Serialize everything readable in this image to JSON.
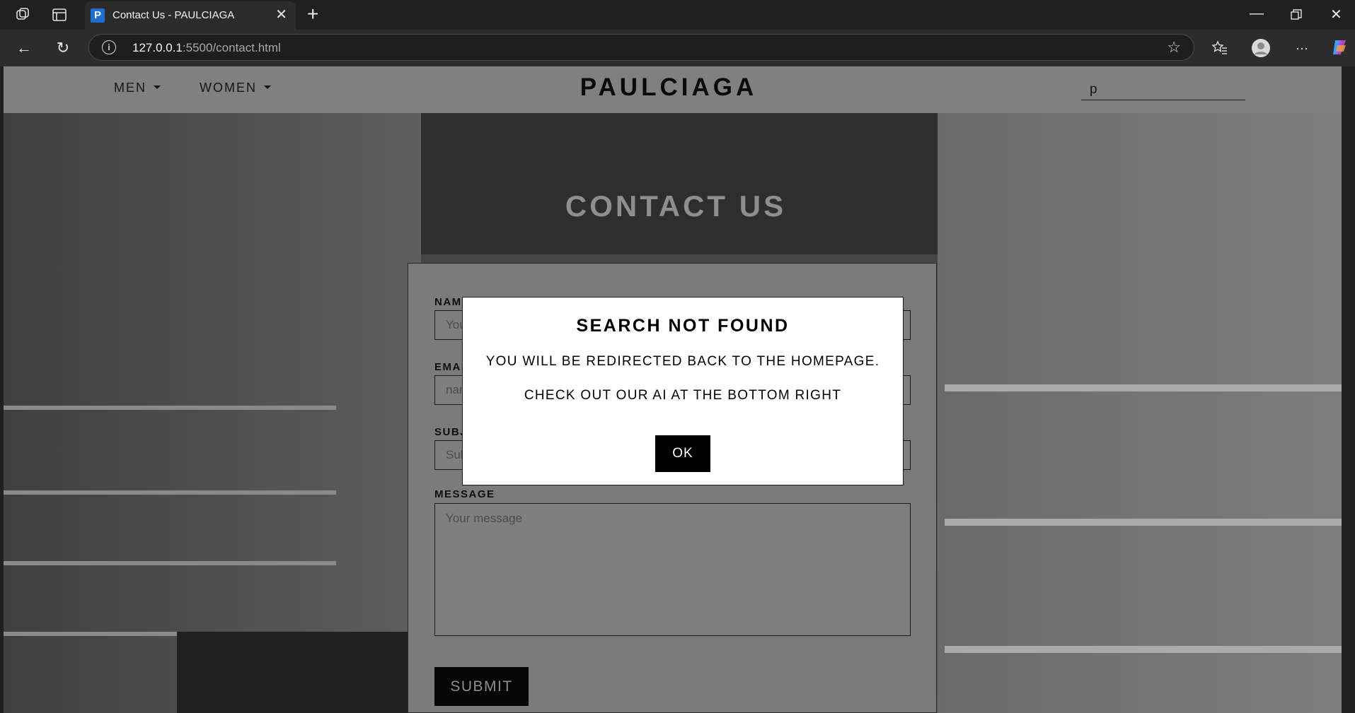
{
  "browser": {
    "tab": {
      "favicon_letter": "P",
      "title": "Contact Us - PAULCIAGA"
    },
    "address": {
      "host": "127.0.0.1",
      "rest": ":5500/contact.html"
    }
  },
  "nav": {
    "items": [
      {
        "label": "MEN"
      },
      {
        "label": "WOMEN"
      }
    ],
    "brand": "PAULCIAGA",
    "search_value": "p"
  },
  "page": {
    "title": "CONTACT US"
  },
  "form": {
    "name_label": "NAME",
    "name_placeholder": "Your name",
    "email_label": "EMAIL",
    "email_placeholder": "name@example.com",
    "subject_label": "SUBJECT",
    "subject_placeholder": "Subject",
    "message_label": "MESSAGE",
    "message_placeholder": "Your message",
    "submit_label": "SUBMIT"
  },
  "modal": {
    "title": "SEARCH NOT FOUND",
    "line1": "YOU WILL BE REDIRECTED BACK TO THE HOMEPAGE.",
    "line2": "CHECK OUT OUR AI AT THE BOTTOM RIGHT",
    "ok_label": "OK"
  },
  "icons": {
    "refresh": "↻",
    "back": "←",
    "favorite": "☆",
    "more": "···"
  }
}
